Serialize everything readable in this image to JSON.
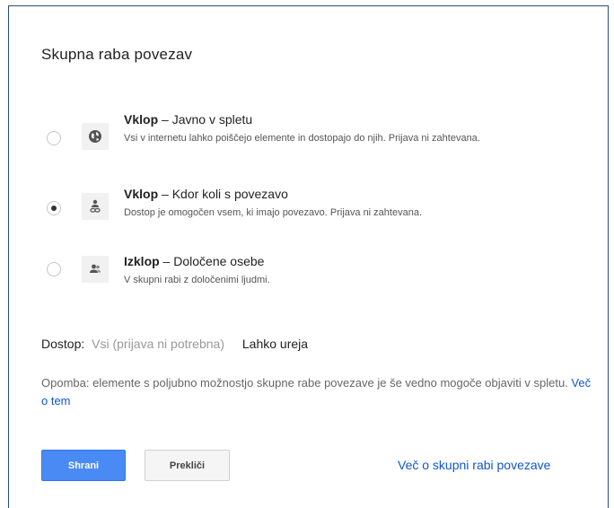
{
  "dialog": {
    "title": "Skupna raba povezav"
  },
  "options": [
    {
      "title_bold": "Vklop",
      "title_rest": " – Javno v spletu",
      "description": "Vsi v internetu lahko poiščejo elemente in dostopajo do njih. Prijava ni zahtevana.",
      "icon": "globe-icon",
      "selected": false
    },
    {
      "title_bold": "Vklop",
      "title_rest": " – Kdor koli s povezavo",
      "description": "Dostop je omogočen vsem, ki imajo povezavo. Prijava ni zahtevana.",
      "icon": "person-link-icon",
      "selected": true
    },
    {
      "title_bold": "Izklop",
      "title_rest": " – Določene osebe",
      "description": "V skupni rabi z določenimi ljudmi.",
      "icon": "people-icon",
      "selected": false
    }
  ],
  "access": {
    "label": "Dostop:",
    "value": "Vsi (prijava ni potrebna)",
    "permission": "Lahko ureja"
  },
  "note": {
    "text": "Opomba: elemente s poljubno možnostjo skupne rabe povezave je še vedno mogoče objaviti v spletu. ",
    "link": "Več o tem"
  },
  "buttons": {
    "save": "Shrani",
    "cancel": "Prekliči"
  },
  "footer_link": "Več o skupni rabi povezave",
  "colors": {
    "accent": "#4a8af4",
    "link": "#1155cc",
    "border": "#2a4b7c"
  }
}
